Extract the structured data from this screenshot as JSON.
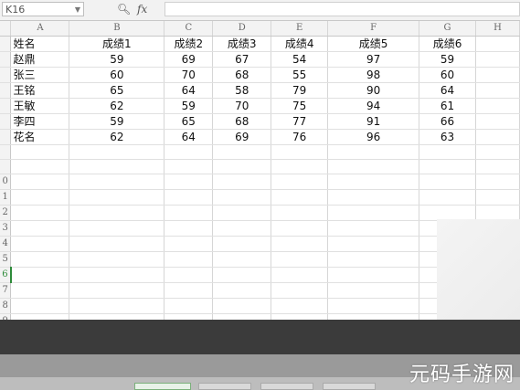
{
  "formula_bar": {
    "name_box": "K16",
    "zoom_icon": "search-icon",
    "fx_label": "fx",
    "formula": ""
  },
  "columns": [
    "A",
    "B",
    "C",
    "D",
    "E",
    "F",
    "G",
    "H"
  ],
  "header_row": [
    "姓名",
    "成绩1",
    "成绩2",
    "成绩3",
    "成绩4",
    "成绩5",
    "成绩6"
  ],
  "rows": [
    [
      "赵鼎",
      "59",
      "69",
      "67",
      "54",
      "97",
      "59"
    ],
    [
      "张三",
      "60",
      "70",
      "68",
      "55",
      "98",
      "60"
    ],
    [
      "王铭",
      "65",
      "64",
      "58",
      "79",
      "90",
      "64"
    ],
    [
      "王敏",
      "62",
      "59",
      "70",
      "75",
      "94",
      "61"
    ],
    [
      "李四",
      "59",
      "65",
      "68",
      "77",
      "91",
      "66"
    ],
    [
      "花名",
      "62",
      "64",
      "69",
      "76",
      "96",
      "63"
    ]
  ],
  "row_numbers": [
    "",
    "",
    "",
    "",
    "",
    "",
    "",
    "",
    "",
    "0",
    "1",
    "2",
    "3",
    "4",
    "5",
    "6",
    "7",
    "8",
    "9"
  ],
  "active_row_index": 15,
  "watermark": "元码手游网",
  "colors": {
    "active_green": "#2e8b3a",
    "header_bg": "#f3f3f3",
    "taskbar_dark": "#3b3b3b"
  }
}
